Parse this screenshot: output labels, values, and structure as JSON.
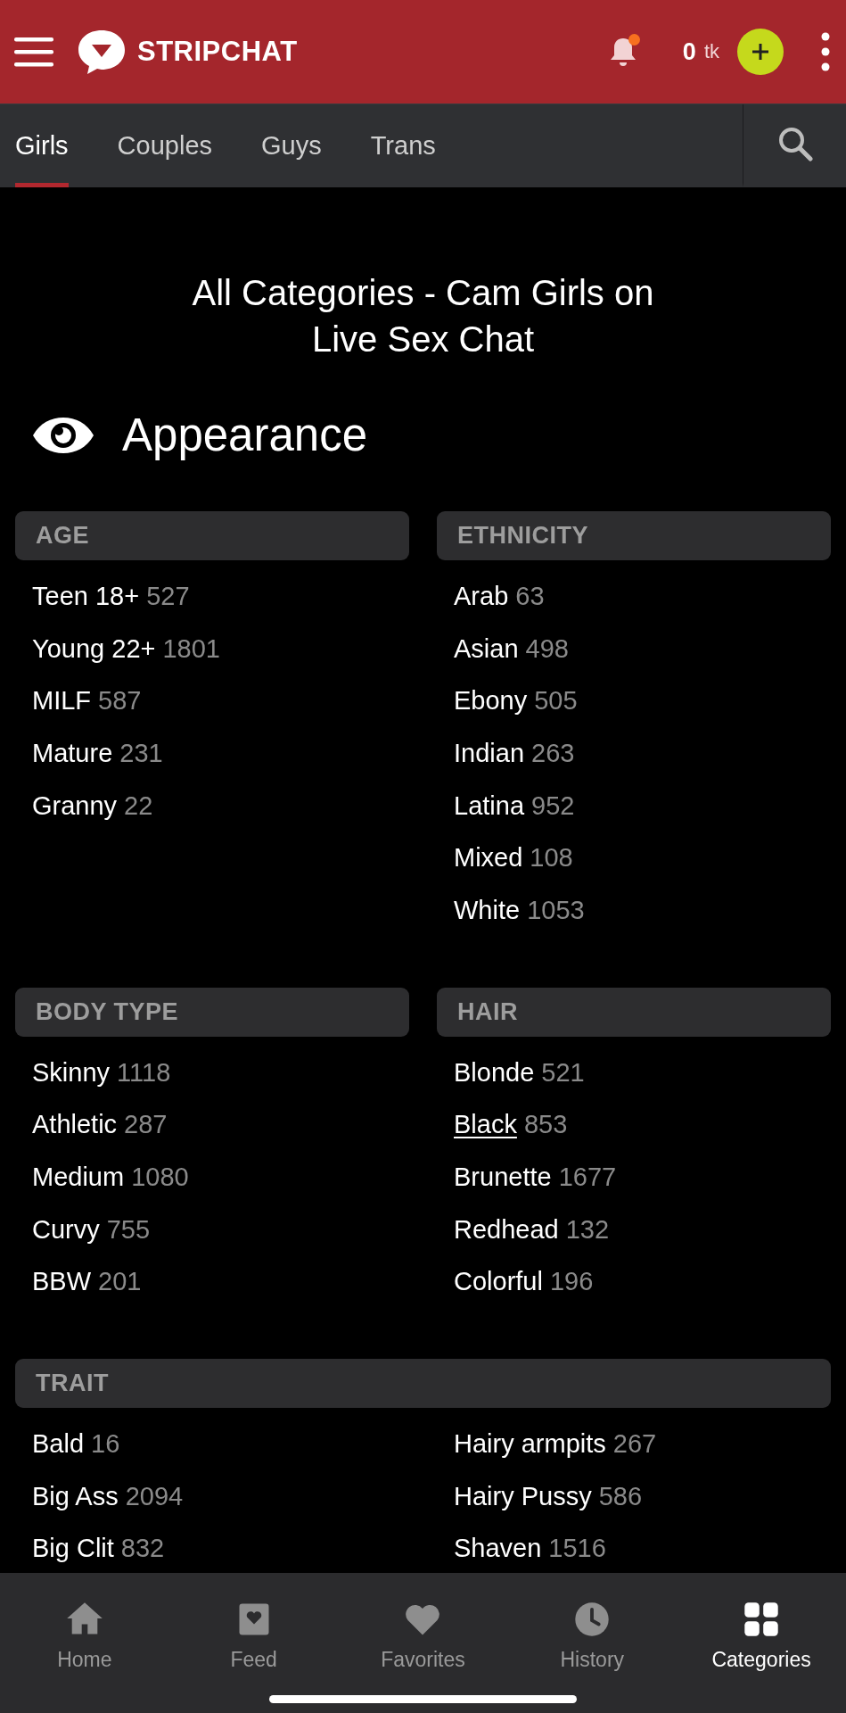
{
  "header": {
    "brand": "STRIPCHAT",
    "notification_dot": true,
    "balance": "0",
    "balance_unit": "tk"
  },
  "tabs": [
    {
      "label": "Girls",
      "selected": true
    },
    {
      "label": "Couples",
      "selected": false
    },
    {
      "label": "Guys",
      "selected": false
    },
    {
      "label": "Trans",
      "selected": false
    }
  ],
  "page_title": "All Categories - Cam Girls on Live Sex Chat",
  "section": {
    "title": "Appearance",
    "groups": [
      {
        "title": "AGE",
        "wide": false,
        "items": [
          {
            "label": "Teen 18+",
            "count": "527",
            "focused": false
          },
          {
            "label": "Young 22+",
            "count": "1801",
            "focused": false
          },
          {
            "label": "MILF",
            "count": "587",
            "focused": false
          },
          {
            "label": "Mature",
            "count": "231",
            "focused": false
          },
          {
            "label": "Granny",
            "count": "22",
            "focused": false
          }
        ]
      },
      {
        "title": "ETHNICITY",
        "wide": false,
        "items": [
          {
            "label": "Arab",
            "count": "63",
            "focused": false
          },
          {
            "label": "Asian",
            "count": "498",
            "focused": false
          },
          {
            "label": "Ebony",
            "count": "505",
            "focused": false
          },
          {
            "label": "Indian",
            "count": "263",
            "focused": false
          },
          {
            "label": "Latina",
            "count": "952",
            "focused": false
          },
          {
            "label": "Mixed",
            "count": "108",
            "focused": false
          },
          {
            "label": "White",
            "count": "1053",
            "focused": false
          }
        ]
      },
      {
        "title": "BODY TYPE",
        "wide": false,
        "items": [
          {
            "label": "Skinny",
            "count": "1118",
            "focused": false
          },
          {
            "label": "Athletic",
            "count": "287",
            "focused": false
          },
          {
            "label": "Medium",
            "count": "1080",
            "focused": false
          },
          {
            "label": "Curvy",
            "count": "755",
            "focused": false
          },
          {
            "label": "BBW",
            "count": "201",
            "focused": false
          }
        ]
      },
      {
        "title": "HAIR",
        "wide": false,
        "items": [
          {
            "label": "Blonde",
            "count": "521",
            "focused": false
          },
          {
            "label": "Black",
            "count": "853",
            "focused": true
          },
          {
            "label": "Brunette",
            "count": "1677",
            "focused": false
          },
          {
            "label": "Redhead",
            "count": "132",
            "focused": false
          },
          {
            "label": "Colorful",
            "count": "196",
            "focused": false
          }
        ]
      },
      {
        "title": "TRAIT",
        "wide": true,
        "items": [
          {
            "label": "Bald",
            "count": "16",
            "focused": false
          },
          {
            "label": "Hairy armpits",
            "count": "267",
            "focused": false
          },
          {
            "label": "Big Ass",
            "count": "2094",
            "focused": false
          },
          {
            "label": "Hairy Pussy",
            "count": "586",
            "focused": false
          },
          {
            "label": "Big Clit",
            "count": "832",
            "focused": false
          },
          {
            "label": "Shaven",
            "count": "1516",
            "focused": false
          }
        ]
      }
    ]
  },
  "bottom_nav": [
    {
      "label": "Home",
      "selected": false
    },
    {
      "label": "Feed",
      "selected": false
    },
    {
      "label": "Favorites",
      "selected": false
    },
    {
      "label": "History",
      "selected": false
    },
    {
      "label": "Categories",
      "selected": true
    }
  ]
}
